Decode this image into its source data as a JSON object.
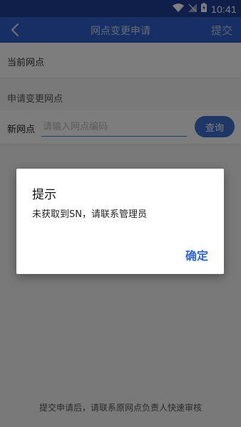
{
  "status_bar": {
    "time": "10:41"
  },
  "header": {
    "title": "网点变更申请",
    "submit_label": "提交"
  },
  "current_station": {
    "label": "当前网点"
  },
  "change_section": {
    "title": "申请变更网点"
  },
  "new_station": {
    "label": "新网点",
    "input_placeholder": "请输入网点编码",
    "input_value": "",
    "query_label": "查询"
  },
  "footer": {
    "note": "提交申请后，请联系原网点负责人快速审核"
  },
  "dialog": {
    "title": "提示",
    "message": "未获取到SN，请联系管理员",
    "ok_label": "确定"
  }
}
